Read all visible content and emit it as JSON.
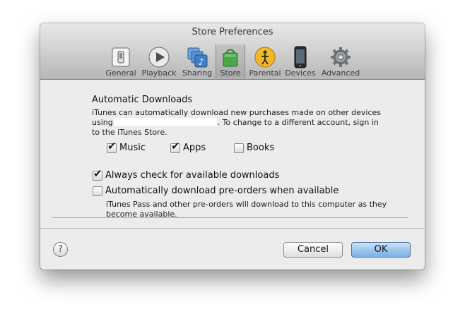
{
  "window": {
    "title": "Store Preferences"
  },
  "toolbar": {
    "items": [
      {
        "label": "General",
        "icon": "general-switch-icon"
      },
      {
        "label": "Playback",
        "icon": "play-icon"
      },
      {
        "label": "Sharing",
        "icon": "music-sharing-icon"
      },
      {
        "label": "Store",
        "icon": "shopping-bag-icon",
        "selected": true
      },
      {
        "label": "Parental",
        "icon": "parental-icon"
      },
      {
        "label": "Devices",
        "icon": "iphone-icon"
      },
      {
        "label": "Advanced",
        "icon": "gear-icon"
      }
    ]
  },
  "automatic_downloads": {
    "heading": "Automatic Downloads",
    "desc_before": "iTunes can automatically download new purchases made on other devices using",
    "desc_after": ". To change to a different account, sign in to the iTunes Store.",
    "options": [
      {
        "label": "Music",
        "checked": true
      },
      {
        "label": "Apps",
        "checked": true
      },
      {
        "label": "Books",
        "checked": false
      }
    ]
  },
  "settings": {
    "always_check": {
      "label": "Always check for available downloads",
      "checked": true
    },
    "preorders": {
      "label": "Automatically download pre-orders when available",
      "checked": false
    },
    "note": "iTunes Pass and other pre-orders will download to this computer as they become available."
  },
  "buttons": {
    "help": "?",
    "cancel": "Cancel",
    "ok": "OK"
  },
  "colors": {
    "accent": "#8fbdea",
    "background": "#ececec"
  }
}
